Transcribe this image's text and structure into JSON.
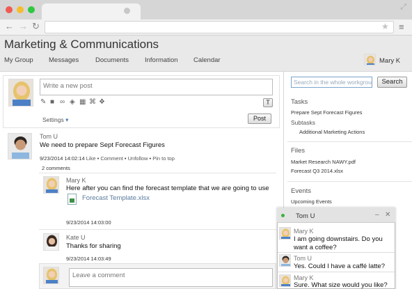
{
  "browser": {
    "back_icon": "arrow-left-icon",
    "forward_icon": "arrow-right-icon",
    "reload_icon": "reload-icon"
  },
  "header": {
    "title": "Marketing & Communications",
    "nav": [
      "My Group",
      "Messages",
      "Documents",
      "Information",
      "Calendar"
    ],
    "user_name": "Mary K"
  },
  "composer": {
    "placeholder": "Write a new post",
    "settings_label": "Settings",
    "post_label": "Post",
    "text_tool": "T"
  },
  "feed": {
    "post": {
      "author": "Tom U",
      "text": "We need to prepare Sept Forecast Figures",
      "timestamp": "9/23/2014 14:02:14",
      "actions": [
        "Like",
        "Comment",
        "Unfollow",
        "Pin to top"
      ],
      "comments_count": "2 comments"
    },
    "comments": [
      {
        "author": "Mary K",
        "text": "Here after you can find the forecast template that we are going to use",
        "attachment": "Forecast Template.xlsx",
        "timestamp": "9/23/2014 14:03:00"
      },
      {
        "author": "Kate U",
        "text": "Thanks for sharing",
        "timestamp": "9/23/2014 14:03:49"
      }
    ],
    "comment_placeholder": "Leave a comment"
  },
  "sidebar": {
    "search_placeholder": "Search in the whole workgroup",
    "search_button": "Search",
    "tasks_heading": "Tasks",
    "task_item": "Prepare Sept Forecast Figures",
    "subtasks_heading": "Subtasks",
    "subtask_item": "Additional Marketing Actions",
    "files_heading": "Files",
    "files": [
      "Market Research NAWY.pdf",
      "Forecast Q3 2014.xlsx"
    ],
    "events_heading": "Events",
    "events_item": "Upcoming Events"
  },
  "chat": {
    "title": "Tom U",
    "minimize": "–",
    "close": "✕",
    "messages": [
      {
        "author": "Mary K",
        "text": "I am going downstairs. Do you want a coffee?"
      },
      {
        "author": "Tom U",
        "text": "Yes. Could I have a caffé latte?"
      },
      {
        "author": "Mary K",
        "text": "Sure. What size would you like?"
      }
    ]
  },
  "colors": {
    "accent_link": "#5a7b9e",
    "online": "#3cb043"
  }
}
